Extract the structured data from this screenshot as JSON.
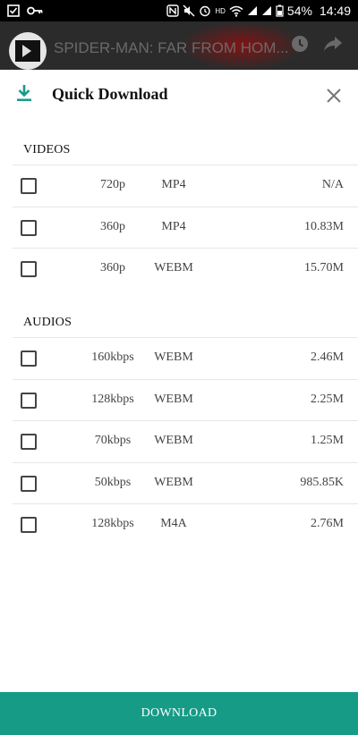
{
  "status_bar": {
    "battery": "54%",
    "time": "14:49",
    "hd_label": "HD"
  },
  "video": {
    "title": "SPIDER-MAN: FAR FROM HOM..."
  },
  "dialog": {
    "title": "Quick Download",
    "videos_label": "VIDEOS",
    "audios_label": "AUDIOS",
    "videos": [
      {
        "quality": "720p",
        "format": "MP4",
        "size": "N/A"
      },
      {
        "quality": "360p",
        "format": "MP4",
        "size": "10.83M"
      },
      {
        "quality": "360p",
        "format": "WEBM",
        "size": "15.70M"
      }
    ],
    "audios": [
      {
        "quality": "160kbps",
        "format": "WEBM",
        "size": "2.46M"
      },
      {
        "quality": "128kbps",
        "format": "WEBM",
        "size": "2.25M"
      },
      {
        "quality": "70kbps",
        "format": "WEBM",
        "size": "1.25M"
      },
      {
        "quality": "50kbps",
        "format": "WEBM",
        "size": "985.85K"
      },
      {
        "quality": "128kbps",
        "format": "M4A",
        "size": "2.76M"
      }
    ],
    "download_label": "DOWNLOAD"
  },
  "colors": {
    "accent": "#169b86",
    "dialog_bg": "#ffffff",
    "status_bg": "#000000"
  }
}
